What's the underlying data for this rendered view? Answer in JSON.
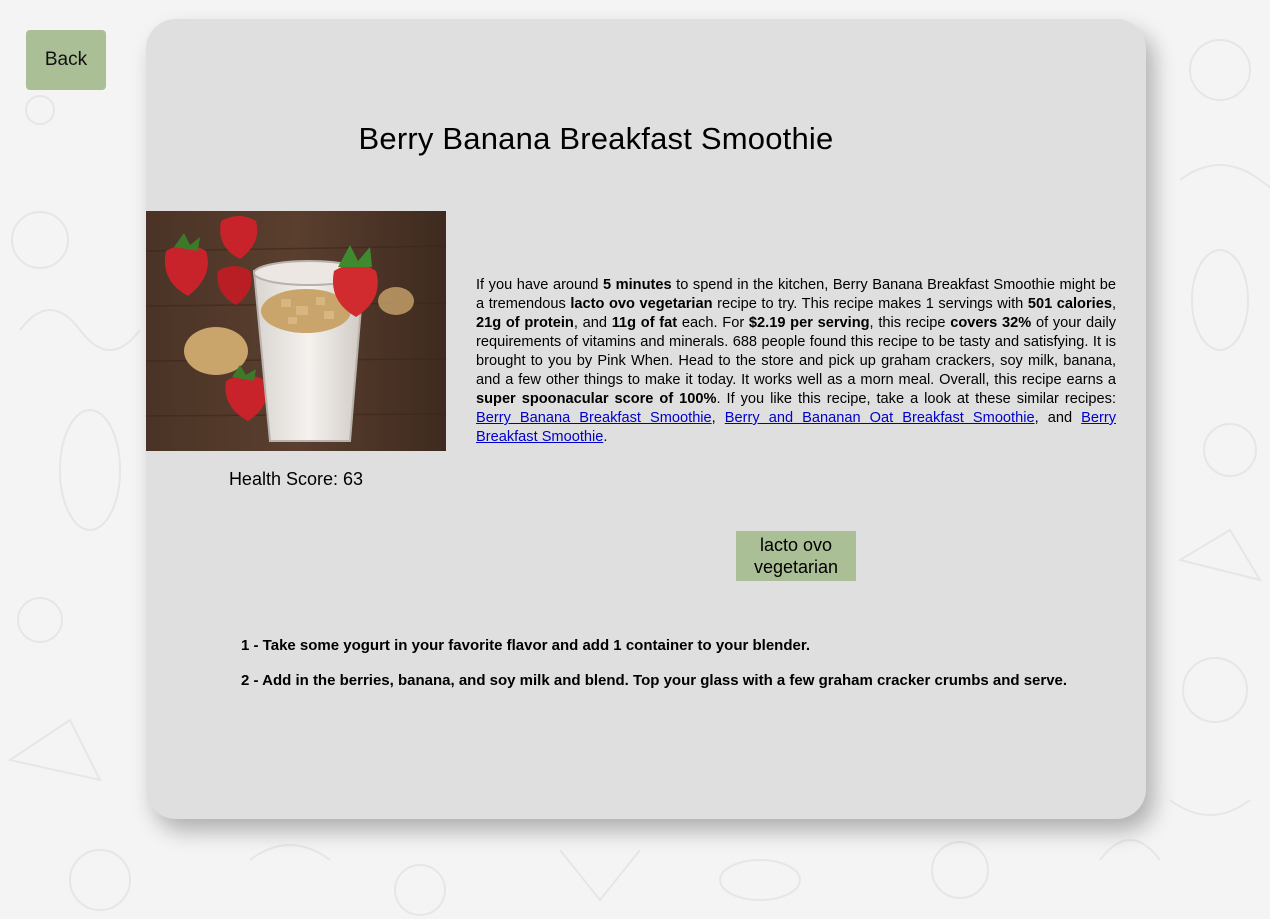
{
  "back_label": "Back",
  "recipe": {
    "title": "Berry Banana Breakfast Smoothie",
    "image_alt": "Berry Banana Breakfast Smoothie",
    "health_score_label": "Health Score:",
    "health_score": "63",
    "summary": {
      "t1": "If you have around ",
      "time": "5 minutes",
      "t2": " to spend in the kitchen, Berry Banana Breakfast Smoothie might be a tremendous ",
      "diet": "lacto ovo vegetarian",
      "t3": " recipe to try. This recipe makes 1 servings with ",
      "calories": "501 calories",
      "t4": ", ",
      "protein": "21g of protein",
      "t5": ", and ",
      "fat": "11g of fat",
      "t6": " each. For ",
      "price": "$2.19 per serving",
      "t7": ", this recipe ",
      "covers": "covers 32%",
      "t8": " of your daily requirements of vitamins and minerals. 688 people found this recipe to be tasty and satisfying. It is brought to you by Pink When. Head to the store and pick up graham crackers, soy milk, banana, and a few other things to make it today. It works well as a morn meal. Overall, this recipe earns a ",
      "score": "super spoonacular score of 100%",
      "t9": ". If you like this recipe, take a look at these similar recipes: ",
      "link1": "Berry Banana Breakfast Smoothie",
      "t10": ", ",
      "link2": "Berry and Bananan Oat Breakfast Smoothie",
      "t11": ", and ",
      "link3": "Berry Breakfast Smoothie",
      "t12": "."
    },
    "diets": [
      "lacto ovo vegetarian"
    ],
    "steps": [
      "1 - Take some yogurt in your favorite flavor and add 1 container to your blender.",
      "2 - Add in the berries, banana, and soy milk and blend. Top your glass with a few graham cracker crumbs and serve."
    ]
  },
  "colors": {
    "accent": "#aabf96",
    "card": "#dfdfdf",
    "link": "#0000cc"
  }
}
